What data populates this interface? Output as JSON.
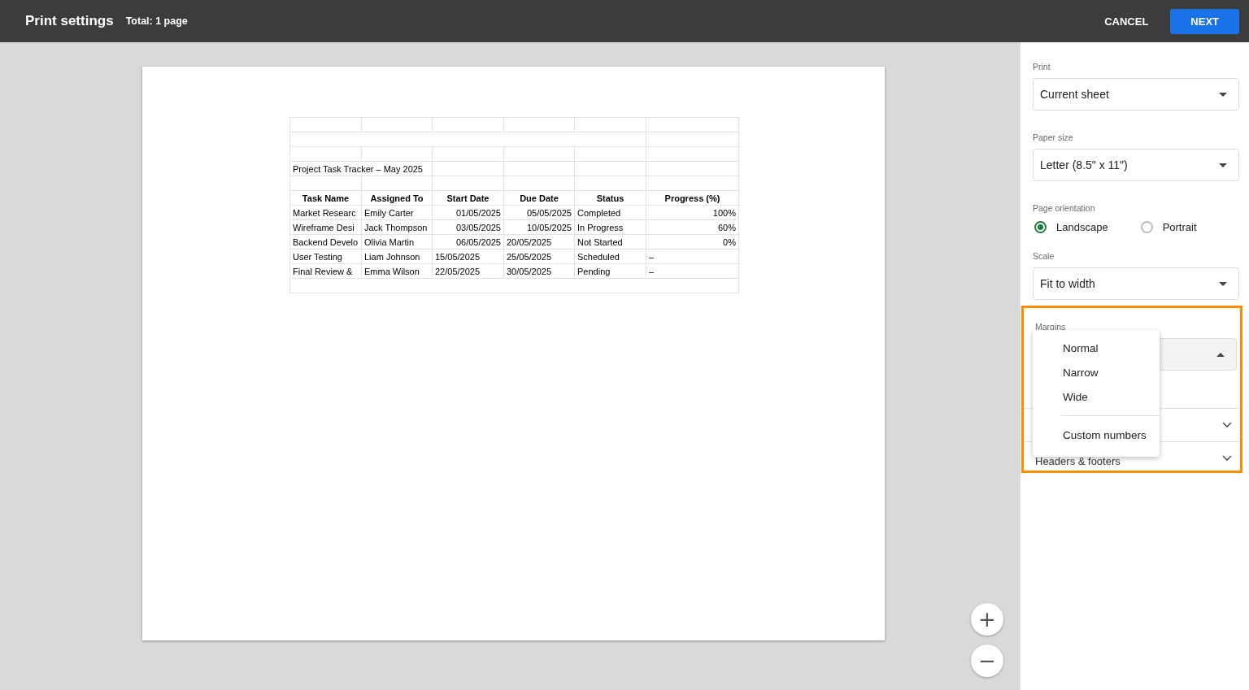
{
  "header": {
    "title": "Print settings",
    "total": "Total: 1 page",
    "buttons": [
      {
        "label": "CANCEL",
        "kind": "text"
      },
      {
        "label": "NEXT",
        "kind": "primary"
      }
    ]
  },
  "preview": {
    "sheet": {
      "rows": [
        {
          "kind": "blank"
        },
        {
          "kind": "merged"
        },
        {
          "kind": "blank"
        },
        {
          "kind": "title",
          "text": "Project Task Tracker – May 2025"
        },
        {
          "kind": "blank"
        },
        {
          "kind": "header",
          "cells": [
            "Task Name",
            "Assigned To",
            "Start Date",
            "Due Date",
            "Status",
            "Progress (%)"
          ]
        },
        {
          "kind": "data",
          "cells": [
            {
              "text": "Market Researc",
              "numeric": false
            },
            {
              "text": "Emily Carter",
              "numeric": false
            },
            {
              "text": "01/05/2025",
              "numeric": true
            },
            {
              "text": "05/05/2025",
              "numeric": true
            },
            {
              "text": "Completed",
              "numeric": false
            },
            {
              "text": "100%",
              "numeric": true
            }
          ]
        },
        {
          "kind": "data",
          "cells": [
            {
              "text": "Wireframe Desi",
              "numeric": false
            },
            {
              "text": "Jack Thompson",
              "numeric": false
            },
            {
              "text": "03/05/2025",
              "numeric": true
            },
            {
              "text": "10/05/2025",
              "numeric": true
            },
            {
              "text": "In Progress",
              "numeric": false
            },
            {
              "text": "60%",
              "numeric": true
            }
          ]
        },
        {
          "kind": "data",
          "cells": [
            {
              "text": "Backend Develo",
              "numeric": false
            },
            {
              "text": "Olivia Martin",
              "numeric": false
            },
            {
              "text": "06/05/2025",
              "numeric": true
            },
            {
              "text": "20/05/2025",
              "numeric": false
            },
            {
              "text": "Not Started",
              "numeric": false
            },
            {
              "text": "0%",
              "numeric": true
            }
          ]
        },
        {
          "kind": "data",
          "cells": [
            {
              "text": "User Testing",
              "numeric": false
            },
            {
              "text": "Liam Johnson",
              "numeric": false
            },
            {
              "text": "15/05/2025",
              "numeric": false
            },
            {
              "text": "25/05/2025",
              "numeric": false
            },
            {
              "text": "Scheduled",
              "numeric": false
            },
            {
              "text": "–",
              "numeric": false
            }
          ]
        },
        {
          "kind": "data",
          "cells": [
            {
              "text": "Final Review &",
              "numeric": false
            },
            {
              "text": "Emma Wilson",
              "numeric": false
            },
            {
              "text": "22/05/2025",
              "numeric": false
            },
            {
              "text": "30/05/2025",
              "numeric": false
            },
            {
              "text": "Pending",
              "numeric": false
            },
            {
              "text": "–",
              "numeric": false
            }
          ]
        },
        {
          "kind": "blank_full"
        }
      ]
    },
    "zoom_buttons": [
      {
        "label": "+"
      },
      {
        "label": "−"
      }
    ]
  },
  "settings": {
    "print": {
      "label": "Print",
      "value": "Current sheet"
    },
    "paper_size": {
      "label": "Paper size",
      "value": "Letter (8.5\" x 11\")"
    },
    "orientation": {
      "label": "Page orientation",
      "options": [
        {
          "label": "Landscape",
          "selected": true
        },
        {
          "label": "Portrait",
          "selected": false
        }
      ]
    },
    "scale": {
      "label": "Scale",
      "value": "Fit to width"
    },
    "margins": {
      "label": "Margins",
      "highlighted": true,
      "expanded": true,
      "options": [
        {
          "label": "Normal",
          "kind": "option"
        },
        {
          "label": "Narrow",
          "kind": "option"
        },
        {
          "label": "Wide",
          "kind": "option"
        },
        {
          "kind": "divider"
        },
        {
          "label": "Custom numbers",
          "kind": "option"
        }
      ]
    },
    "sections": [
      {
        "expanded": false
      },
      {
        "label": "Headers & footers",
        "expanded": false
      }
    ]
  }
}
